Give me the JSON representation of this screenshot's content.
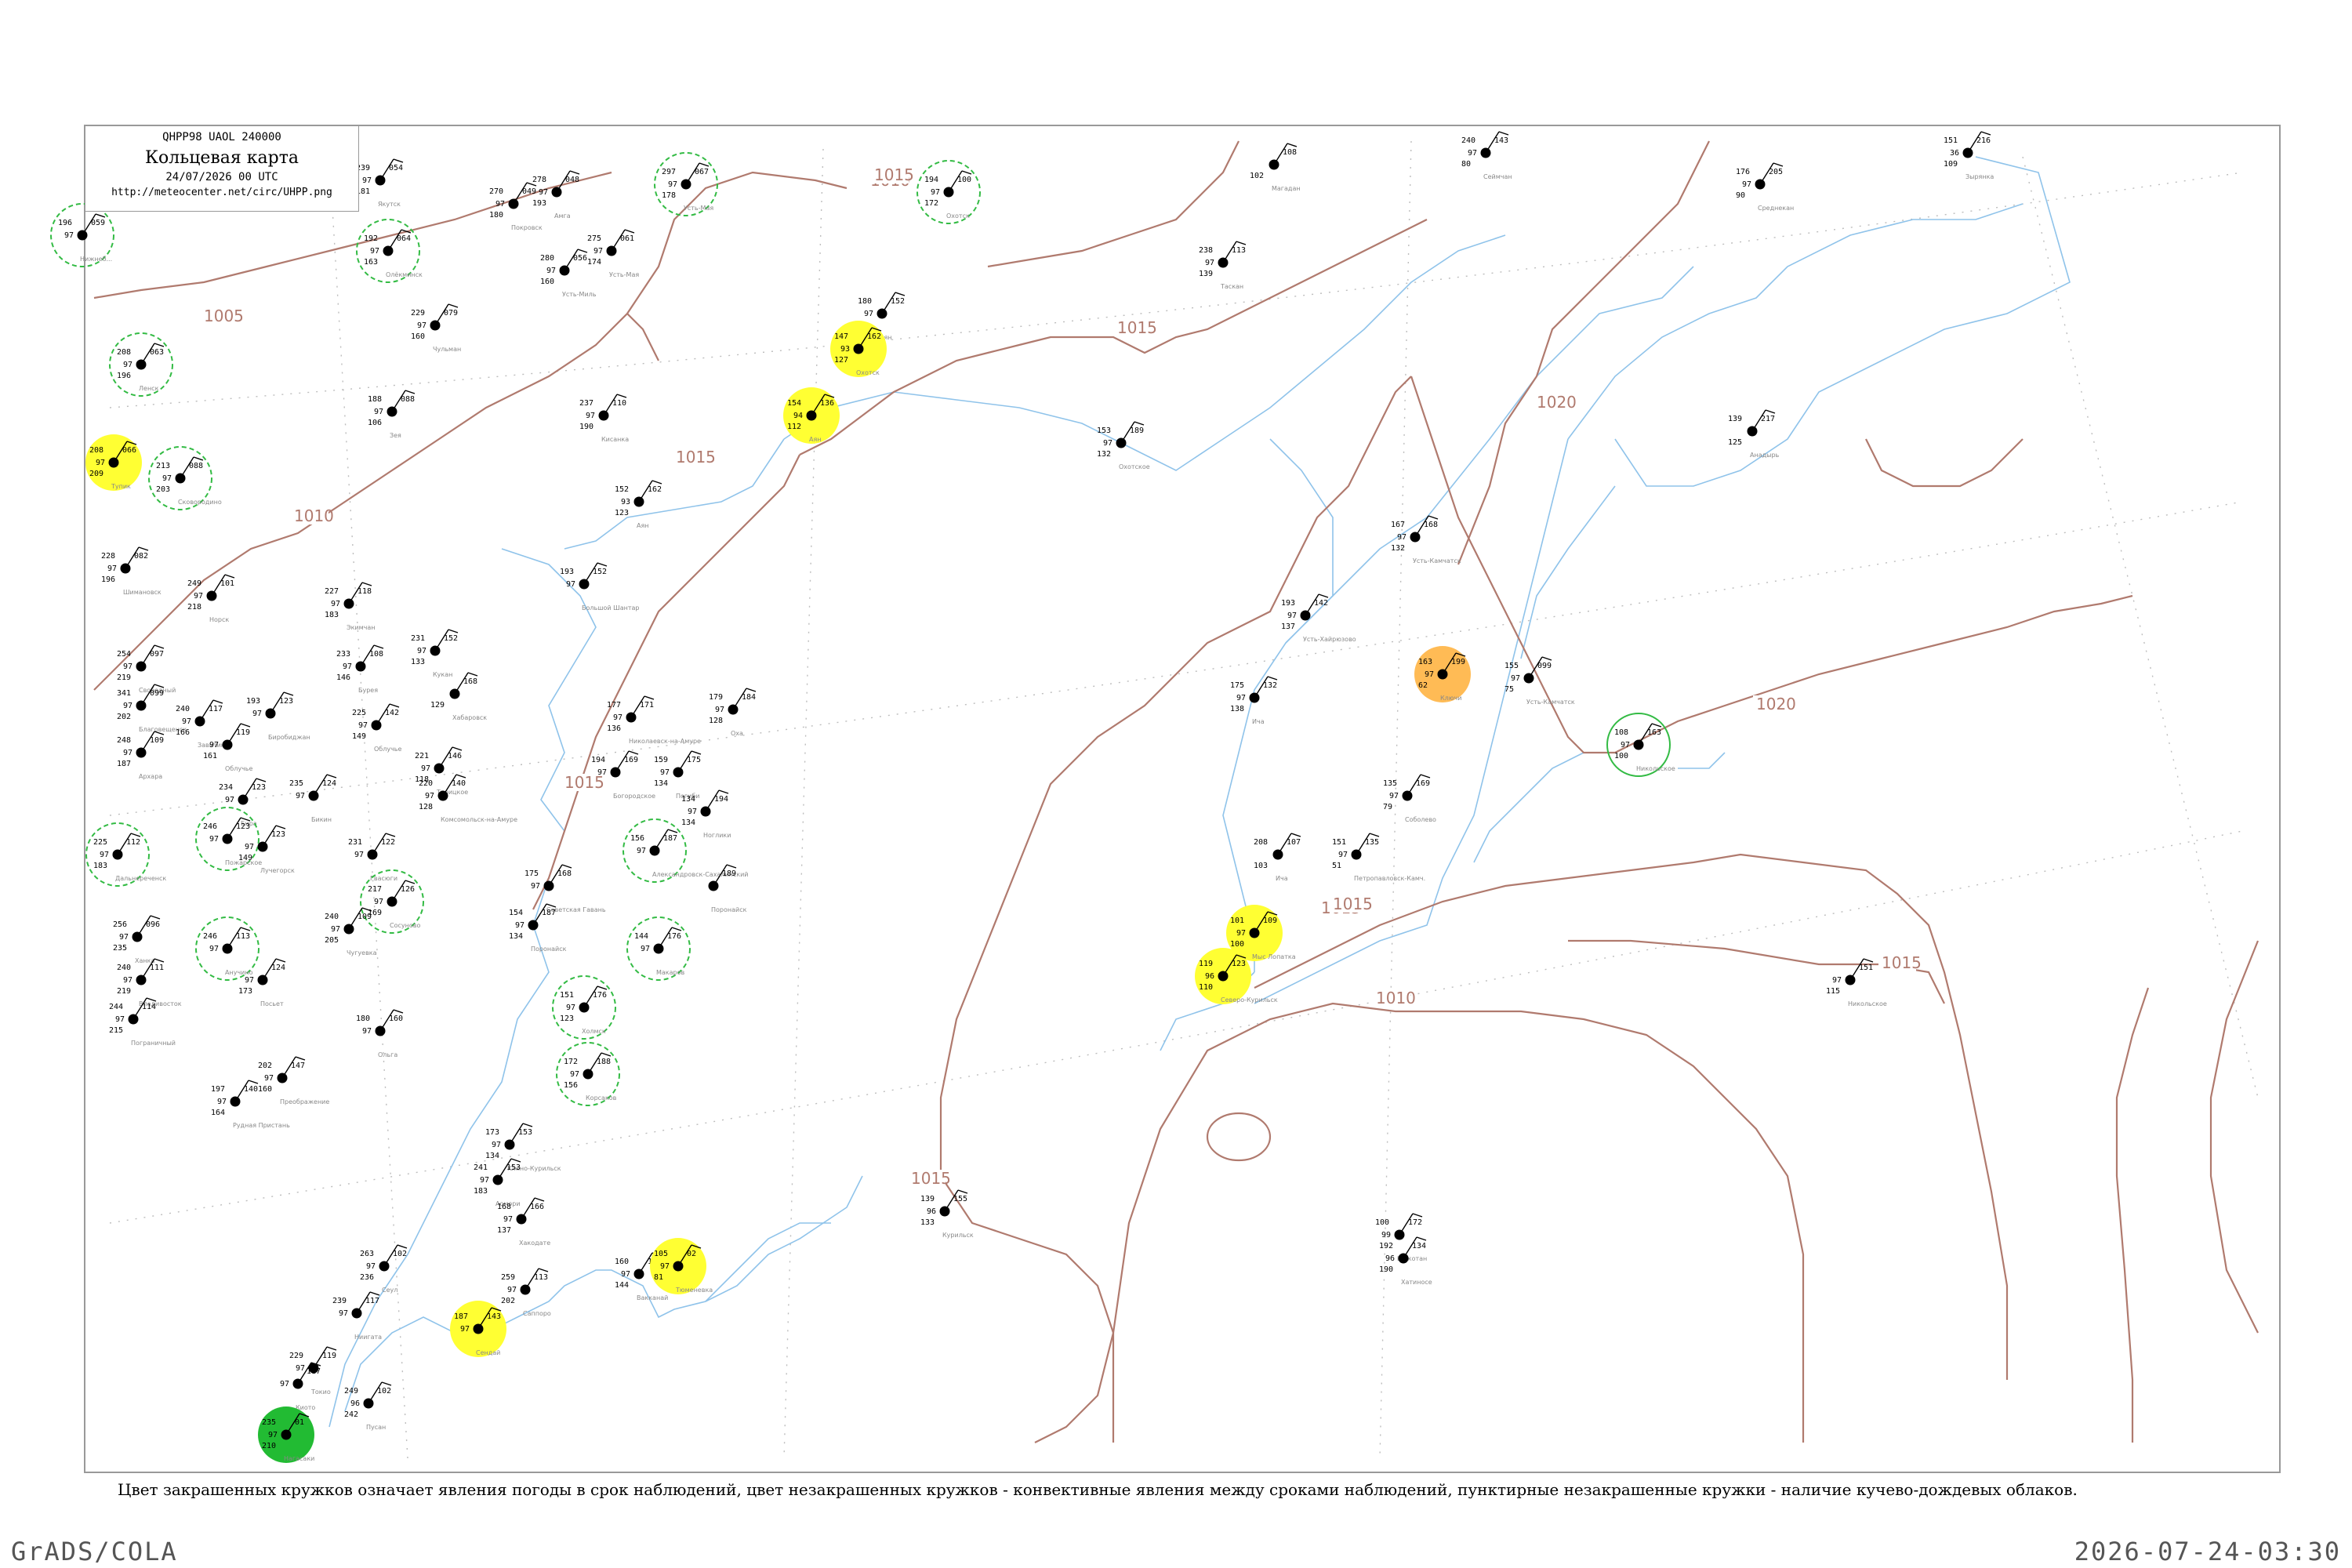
{
  "header": {
    "code": "QHPP98  UAOL  240000",
    "title": "Кольцевая карта",
    "datetime": "24/07/2026 00 UTC",
    "url": "http://meteocenter.net/circ/UHPP.png"
  },
  "legend_text": "Цвет закрашенных кружков означает явления погоды в срок наблюдений, цвет незакрашенных кружков - конвективные явления между сроками наблюдений, пунктирные незакрашенные кружки - наличие кучево-дождевых облаков.",
  "footer": {
    "left": "GrADS/COLA",
    "right": "2026-07-24-03:30"
  },
  "isobar_labels": [
    "1005",
    "1010",
    "1010",
    "1015",
    "1015",
    "1015",
    "1015",
    "1015",
    "1015",
    "1015",
    "1010",
    "1020",
    "1020",
    "1015"
  ],
  "colors": {
    "isobar": "#b07a6e",
    "river": "#8fc3ea",
    "yellow": "#ffff33",
    "green": "#22bb33",
    "orange": "#ffbb55",
    "dashed_ring": "#33bb44"
  },
  "stations": [
    {
      "p": "059",
      "t": "196",
      "d": "97",
      "v": "",
      "name": "Нижнеб..."
    },
    {
      "p": "054",
      "t": "239",
      "d": "97",
      "v": "181",
      "name": "Якутск"
    },
    {
      "p": "049",
      "t": "270",
      "d": "97",
      "v": "180",
      "name": "Покровск"
    },
    {
      "p": "048",
      "t": "278",
      "d": "97",
      "v": "193",
      "name": "Амга"
    },
    {
      "p": "067",
      "t": "297",
      "d": "97",
      "v": "178",
      "name": "Усть-Мая"
    },
    {
      "p": "100",
      "t": "194",
      "d": "97",
      "v": "172",
      "name": "Охотск"
    },
    {
      "p": "108",
      "t": "",
      "d": "",
      "v": "102",
      "name": "Магадан"
    },
    {
      "p": "143",
      "t": "240",
      "d": "97",
      "v": "80",
      "name": "Сеймчан"
    },
    {
      "p": "216",
      "t": "151",
      "d": "36",
      "v": "109",
      "name": "Зырянка"
    },
    {
      "p": "205",
      "t": "176",
      "d": "97",
      "v": "90",
      "name": "Среднекан"
    },
    {
      "p": "064",
      "t": "192",
      "d": "97",
      "v": "163",
      "name": "Олёкминск"
    },
    {
      "p": "061",
      "t": "275",
      "d": "97",
      "v": "174",
      "name": "Усть-Мая"
    },
    {
      "p": "056",
      "t": "280",
      "d": "97",
      "v": "160",
      "name": "Усть-Миль"
    },
    {
      "p": "079",
      "t": "229",
      "d": "97",
      "v": "160",
      "name": "Чульман"
    },
    {
      "p": "152",
      "t": "180",
      "d": "97",
      "v": "",
      "name": "Аян"
    },
    {
      "p": "162",
      "t": "147",
      "d": "93",
      "v": "127",
      "name": "Охотск"
    },
    {
      "p": "136",
      "t": "154",
      "d": "94",
      "v": "112",
      "name": "Аян"
    },
    {
      "p": "113",
      "t": "238",
      "d": "97",
      "v": "139",
      "name": "Таскан"
    },
    {
      "p": "217",
      "t": "139",
      "d": "",
      "v": "125",
      "name": "Анадырь"
    },
    {
      "p": "189",
      "t": "153",
      "d": "97",
      "v": "132",
      "name": "Охотское"
    },
    {
      "p": "063",
      "t": "208",
      "d": "97",
      "v": "196",
      "name": "Ленск"
    },
    {
      "p": "088",
      "t": "188",
      "d": "97",
      "v": "106",
      "name": "Зея"
    },
    {
      "p": "110",
      "t": "237",
      "d": "97",
      "v": "190",
      "name": "Кисанка"
    },
    {
      "p": "066",
      "t": "208",
      "d": "97",
      "v": "209",
      "name": "Тупик"
    },
    {
      "p": "088",
      "t": "213",
      "d": "97",
      "v": "203",
      "name": "Сковородино"
    },
    {
      "p": "162",
      "t": "152",
      "d": "93",
      "v": "123",
      "name": "Аян"
    },
    {
      "p": "168",
      "t": "167",
      "d": "97",
      "v": "132",
      "name": "Усть-Камчатск"
    },
    {
      "p": "082",
      "t": "228",
      "d": "97",
      "v": "196",
      "name": "Шимановск"
    },
    {
      "p": "101",
      "t": "249",
      "d": "97",
      "v": "218",
      "name": "Норск"
    },
    {
      "p": "118",
      "t": "227",
      "d": "97",
      "v": "183",
      "name": "Экимчан"
    },
    {
      "p": "152",
      "t": "193",
      "d": "97",
      "v": "",
      "name": "Большой Шантар"
    },
    {
      "p": "142",
      "t": "193",
      "d": "97",
      "v": "137",
      "name": "Усть-Хайрюзово"
    },
    {
      "p": "199",
      "t": "163",
      "d": "97",
      "v": "62",
      "name": "Ключи"
    },
    {
      "p": "099",
      "t": "155",
      "d": "97",
      "v": "75",
      "name": "Усть-Камчатск"
    },
    {
      "p": "163",
      "t": "108",
      "d": "97",
      "v": "100",
      "name": "Никольское"
    },
    {
      "p": "097",
      "t": "254",
      "d": "97",
      "v": "219",
      "name": "Свободный"
    },
    {
      "p": "108",
      "t": "233",
      "d": "97",
      "v": "146",
      "name": "Бурея"
    },
    {
      "p": "152",
      "t": "231",
      "d": "97",
      "v": "133",
      "name": "Кукан"
    },
    {
      "p": "132",
      "t": "175",
      "d": "97",
      "v": "138",
      "name": "Ича"
    },
    {
      "p": "099",
      "t": "341",
      "d": "97",
      "v": "202",
      "name": "Благовещенск"
    },
    {
      "p": "117",
      "t": "240",
      "d": "97",
      "v": "166",
      "name": "Завитинск"
    },
    {
      "p": "123",
      "t": "193",
      "d": "97",
      "v": "",
      "name": "Биробиджан"
    },
    {
      "p": "142",
      "t": "225",
      "d": "97",
      "v": "149",
      "name": "Облучье"
    },
    {
      "p": "168",
      "t": "",
      "d": "",
      "v": "129",
      "name": "Хабаровск"
    },
    {
      "p": "171",
      "t": "177",
      "d": "97",
      "v": "136",
      "name": "Николаевск-на-Амуре"
    },
    {
      "p": "184",
      "t": "179",
      "d": "97",
      "v": "128",
      "name": "Оха"
    },
    {
      "p": "109",
      "t": "248",
      "d": "97",
      "v": "187",
      "name": "Архара"
    },
    {
      "p": "119",
      "t": "",
      "d": "97",
      "v": "161",
      "name": "Облучье"
    },
    {
      "p": "146",
      "t": "221",
      "d": "97",
      "v": "118",
      "name": "Троицкое"
    },
    {
      "p": "169",
      "t": "194",
      "d": "97",
      "v": "",
      "name": "Богородское"
    },
    {
      "p": "175",
      "t": "159",
      "d": "97",
      "v": "134",
      "name": "Погиби"
    },
    {
      "p": "169",
      "t": "135",
      "d": "97",
      "v": "79",
      "name": "Соболево"
    },
    {
      "p": "123",
      "t": "234",
      "d": "97",
      "v": "",
      "name": "Бира"
    },
    {
      "p": "124",
      "t": "235",
      "d": "97",
      "v": "",
      "name": "Бикин"
    },
    {
      "p": "140",
      "t": "220",
      "d": "97",
      "v": "128",
      "name": "Комсомольск-на-Амуре"
    },
    {
      "p": "194",
      "t": "134",
      "d": "97",
      "v": "134",
      "name": "Ноглики"
    },
    {
      "p": "107",
      "t": "208",
      "d": "",
      "v": "103",
      "name": "Ича"
    },
    {
      "p": "135",
      "t": "151",
      "d": "97",
      "v": "51",
      "name": "Петропавловск-Камч."
    },
    {
      "p": "123",
      "t": "246",
      "d": "97",
      "v": "",
      "name": "Пожарское"
    },
    {
      "p": "123",
      "t": "",
      "d": "97",
      "v": "149",
      "name": "Лучегорск"
    },
    {
      "p": "122",
      "t": "231",
      "d": "97",
      "v": "",
      "name": "Гвасюги"
    },
    {
      "p": "112",
      "t": "225",
      "d": "97",
      "v": "183",
      "name": "Дальнереченск"
    },
    {
      "p": "168",
      "t": "175",
      "d": "97",
      "v": "",
      "name": "Советская Гавань"
    },
    {
      "p": "187",
      "t": "156",
      "d": "97",
      "v": "",
      "name": "Александровск-Сахалинский"
    },
    {
      "p": "189",
      "t": "",
      "d": "",
      "v": "",
      "name": "Поронайск"
    },
    {
      "p": "109",
      "t": "101",
      "d": "97",
      "v": "100",
      "name": "Мыс Лопатка"
    },
    {
      "p": "123",
      "t": "119",
      "d": "96",
      "v": "110",
      "name": "Северо-Курильск"
    },
    {
      "p": "096",
      "t": "256",
      "d": "97",
      "v": "235",
      "name": "Ханка"
    },
    {
      "p": "126",
      "t": "217",
      "d": "97",
      "v": "169",
      "name": "Сосуново"
    },
    {
      "p": "109",
      "t": "240",
      "d": "97",
      "v": "205",
      "name": "Чугуевка"
    },
    {
      "p": "187",
      "t": "154",
      "d": "97",
      "v": "134",
      "name": "Поронайск"
    },
    {
      "p": "176",
      "t": "144",
      "d": "97",
      "v": "",
      "name": "Макаров"
    },
    {
      "p": "113",
      "t": "246",
      "d": "97",
      "v": "",
      "name": "Анучино"
    },
    {
      "p": "111",
      "t": "240",
      "d": "97",
      "v": "219",
      "name": "Владивосток"
    },
    {
      "p": "124",
      "t": "",
      "d": "97",
      "v": "173",
      "name": "Посьет"
    },
    {
      "p": "114",
      "t": "244",
      "d": "97",
      "v": "215",
      "name": "Пограничный"
    },
    {
      "p": "176",
      "t": "151",
      "d": "97",
      "v": "123",
      "name": "Холмск"
    },
    {
      "p": "160",
      "t": "180",
      "d": "97",
      "v": "",
      "name": "Ольга"
    },
    {
      "p": "188",
      "t": "172",
      "d": "97",
      "v": "156",
      "name": "Корсаков"
    },
    {
      "p": "147",
      "t": "202",
      "d": "97",
      "v": "160",
      "name": "Преображение"
    },
    {
      "p": "140",
      "t": "197",
      "d": "97",
      "v": "164",
      "name": "Рудная Пристань"
    },
    {
      "p": "151",
      "t": "",
      "d": "97",
      "v": "115",
      "name": "Никольское"
    },
    {
      "p": "153",
      "t": "173",
      "d": "97",
      "v": "134",
      "name": "Южно-Курильск"
    },
    {
      "p": "153",
      "t": "241",
      "d": "97",
      "v": "183",
      "name": "Аомори"
    },
    {
      "p": "166",
      "t": "168",
      "d": "97",
      "v": "137",
      "name": "Хакодате"
    },
    {
      "p": "148",
      "t": "160",
      "d": "97",
      "v": "144",
      "name": "Вакканай"
    },
    {
      "p": "155",
      "t": "139",
      "d": "96",
      "v": "133",
      "name": "Курильск"
    },
    {
      "p": "02",
      "t": "105",
      "d": "97",
      "v": "81",
      "name": "Тюменевка"
    },
    {
      "p": "172",
      "t": "100",
      "d": "99",
      "v": "",
      "name": "Шикотан"
    },
    {
      "p": "134",
      "t": "192",
      "d": "96",
      "v": "190",
      "name": "Хатиносе"
    },
    {
      "p": "143",
      "t": "187",
      "d": "97",
      "v": "",
      "name": "Сендай"
    },
    {
      "p": "113",
      "t": "259",
      "d": "97",
      "v": "202",
      "name": "Саппоро"
    },
    {
      "p": "117",
      "t": "239",
      "d": "97",
      "v": "",
      "name": "Ниигата"
    },
    {
      "p": "102",
      "t": "263",
      "d": "97",
      "v": "236",
      "name": "Сеул"
    },
    {
      "p": "117",
      "t": "",
      "d": "97",
      "v": "",
      "name": "Киото"
    },
    {
      "p": "119",
      "t": "229",
      "d": "97",
      "v": "",
      "name": "Токио"
    },
    {
      "p": "102",
      "t": "249",
      "d": "96",
      "v": "242",
      "name": "Пусан"
    },
    {
      "p": "01",
      "t": "235",
      "d": "97",
      "v": "210",
      "name": "Нагасаки"
    }
  ]
}
